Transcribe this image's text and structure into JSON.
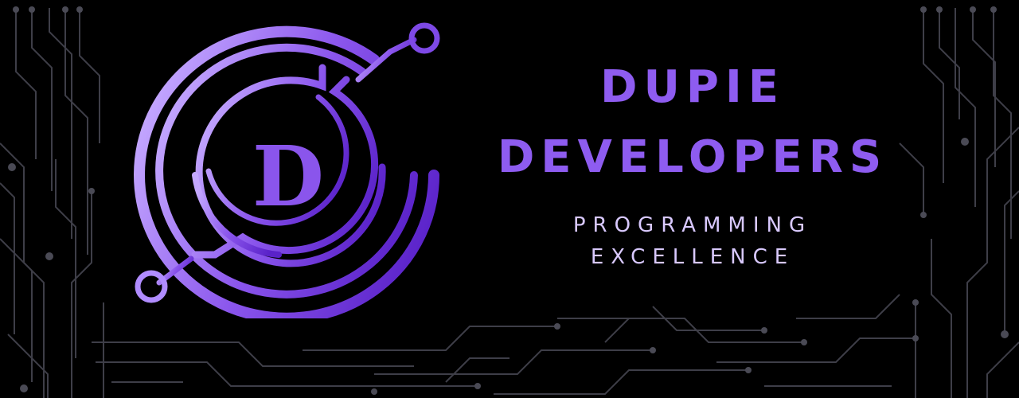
{
  "brand": {
    "line1": "DUPIE",
    "line2": "DEVELOPERS",
    "tagline_line1": "PROGRAMMING",
    "tagline_line2": "EXCELLENCE",
    "monogram": "D"
  },
  "colors": {
    "background": "#000000",
    "brand_purple": "#8e5cf0",
    "light_purple": "#c9b3ff",
    "tagline": "#d9c9ff",
    "circuit_gray": "#4a4a55"
  },
  "icons": {
    "emblem": "circuit-ring-logo-icon",
    "background": "circuit-trace-pattern"
  }
}
